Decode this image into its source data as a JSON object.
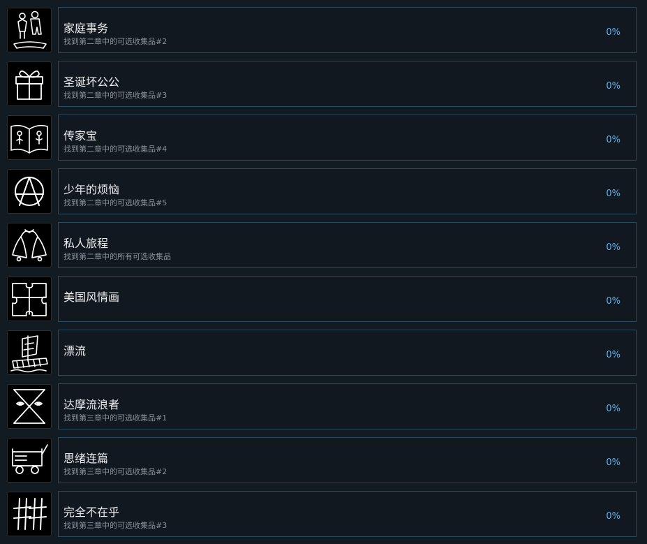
{
  "achievements": [
    {
      "title": "家庭事务",
      "description": "找到第二章中的可选收集品#2",
      "percent": "0%",
      "icon": "family-figures-icon"
    },
    {
      "title": "圣诞坏公公",
      "description": "找到第二章中的可选收集品#3",
      "percent": "0%",
      "icon": "gift-box-icon"
    },
    {
      "title": "传家宝",
      "description": "找到第二章中的可选收集品#4",
      "percent": "0%",
      "icon": "open-book-icon"
    },
    {
      "title": "少年的烦恼",
      "description": "找到第二章中的可选收集品#5",
      "percent": "0%",
      "icon": "anarchy-symbol-icon"
    },
    {
      "title": "私人旅程",
      "description": "找到第二章中的所有可选收集品",
      "percent": "0%",
      "icon": "bells-icon"
    },
    {
      "title": "美国风情画",
      "description": "",
      "percent": "0%",
      "icon": "puzzle-piece-icon"
    },
    {
      "title": "漂流",
      "description": "",
      "percent": "0%",
      "icon": "raft-icon"
    },
    {
      "title": "达摩流浪者",
      "description": "找到第三章中的可选收集品#1",
      "percent": "0%",
      "icon": "hourglass-eyes-icon"
    },
    {
      "title": "思绪连篇",
      "description": "找到第三章中的可选收集品#2",
      "percent": "0%",
      "icon": "wagon-icon"
    },
    {
      "title": "完全不在乎",
      "description": "找到第三章中的可选收集品#3",
      "percent": "0%",
      "icon": "hash-marks-icon"
    }
  ]
}
